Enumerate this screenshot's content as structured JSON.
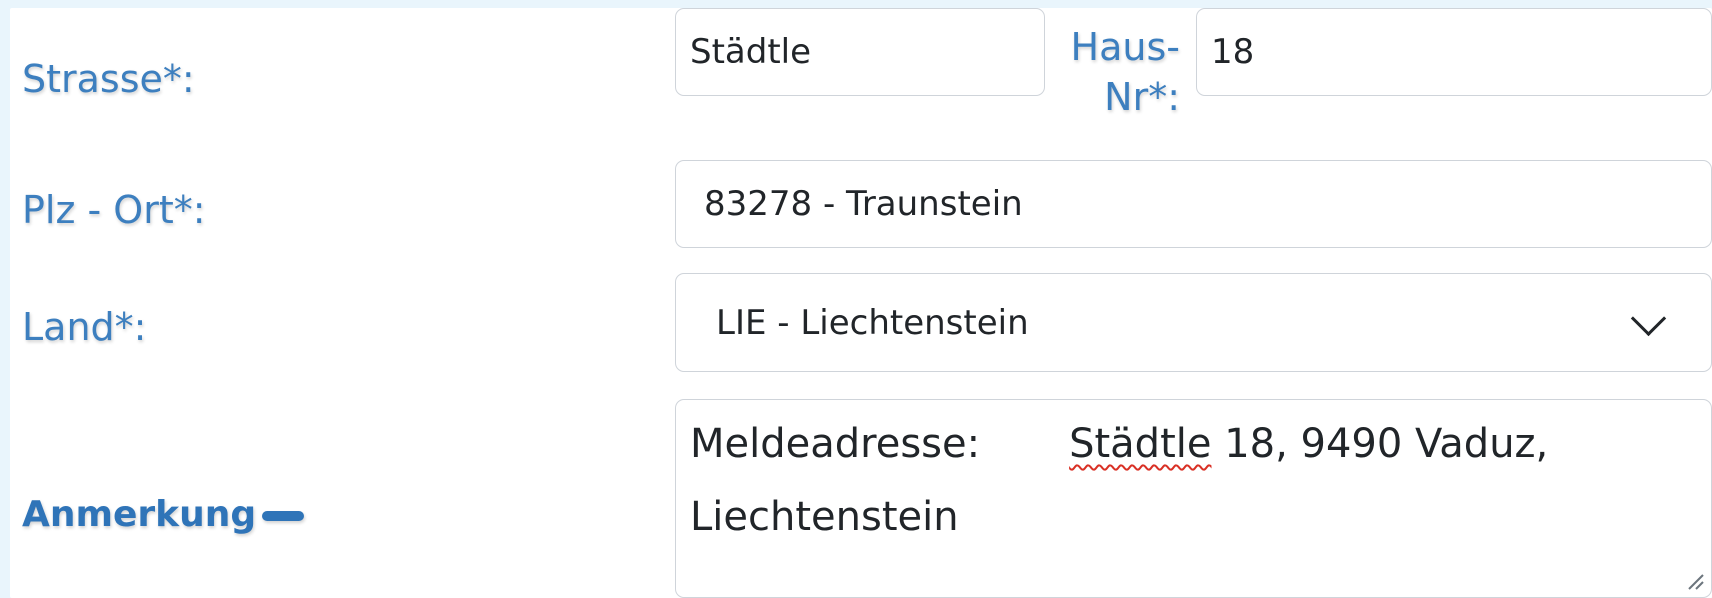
{
  "address_form": {
    "street": {
      "label": "Strasse*:",
      "value": "Städtle"
    },
    "house_number": {
      "label_line1": "Haus-",
      "label_line2": "Nr*:",
      "value": "18"
    },
    "postal_city": {
      "label": "Plz - Ort*:",
      "value": "83278 - Traunstein"
    },
    "country": {
      "label": "Land*:",
      "selected": "LIE - Liechtenstein"
    },
    "note": {
      "label": "Anmerkung",
      "prefix": "Meldeadresse:       ",
      "misspelled_word": "Städtle",
      "rest": " 18, 9490 Vaduz,\nLiechtenstein"
    }
  },
  "icons": {
    "country_dropdown": "chevron-down-icon",
    "note_toggle": "minus-icon",
    "note_resize": "resize-handle-icon"
  },
  "colors": {
    "label_blue": "#3d7fbf",
    "heading_blue": "#2f74b8",
    "border": "#cfd4da",
    "page_background": "#e9f5fc",
    "spellcheck_red": "#d93025"
  }
}
